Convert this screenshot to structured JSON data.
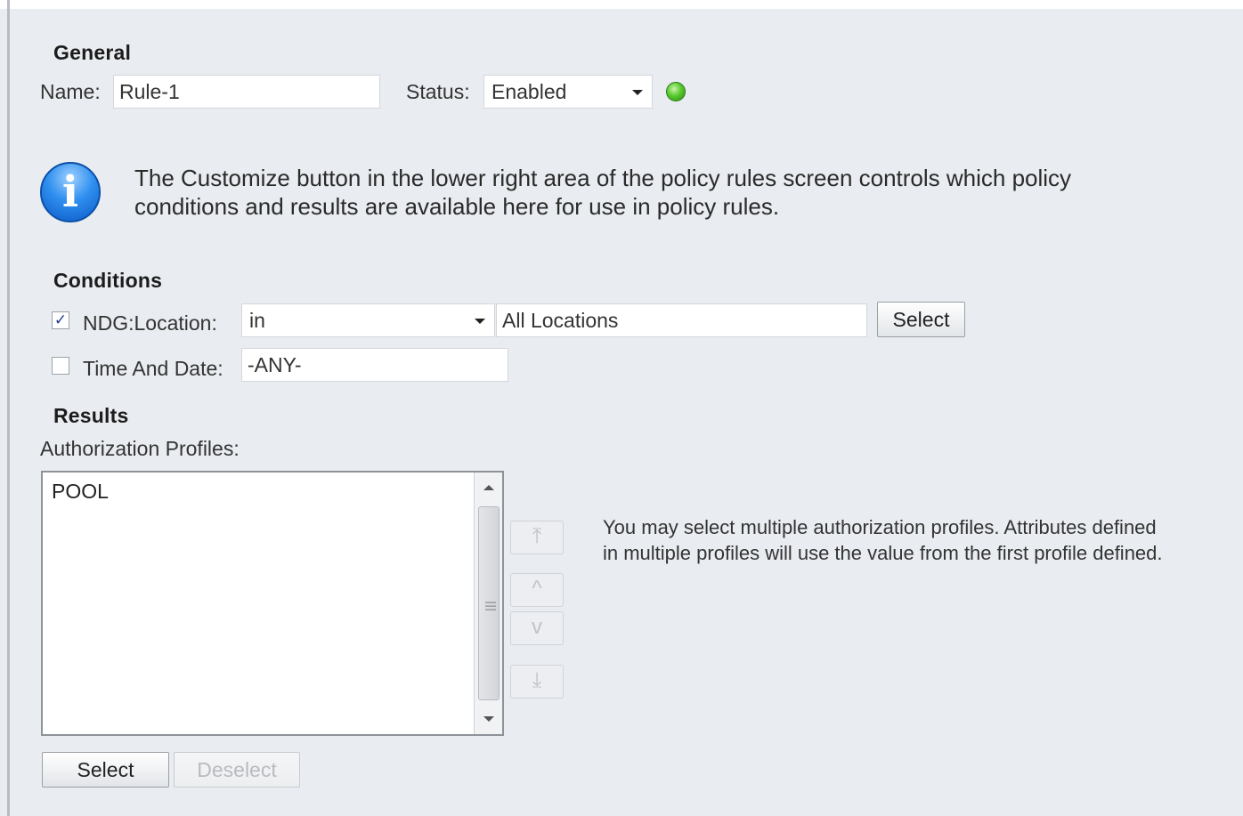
{
  "general": {
    "heading": "General",
    "name_label": "Name:",
    "name_value": "Rule-1",
    "status_label": "Status:",
    "status_value": "Enabled",
    "status_color": "#4cbf2a"
  },
  "info": {
    "icon": "info-icon",
    "line1": "The Customize button in the lower right area of the policy rules screen controls which policy",
    "line2": "conditions and results are available here for use in policy rules."
  },
  "conditions": {
    "heading": "Conditions",
    "ndg": {
      "checked": true,
      "label": "NDG:Location:",
      "operator": "in",
      "value": "All Locations",
      "select_label": "Select"
    },
    "time": {
      "checked": false,
      "label": "Time And Date:",
      "value": "-ANY-"
    }
  },
  "results": {
    "heading": "Results",
    "profiles_label": "Authorization Profiles:",
    "profiles": [
      "POOL"
    ],
    "select_label": "Select",
    "deselect_label": "Deselect",
    "order_icons": [
      "move-top-icon",
      "move-up-icon",
      "move-down-icon",
      "move-bottom-icon"
    ],
    "note_line1": "You may select multiple authorization profiles. Attributes defined",
    "note_line2": "in multiple profiles will use the value from the first profile defined."
  }
}
